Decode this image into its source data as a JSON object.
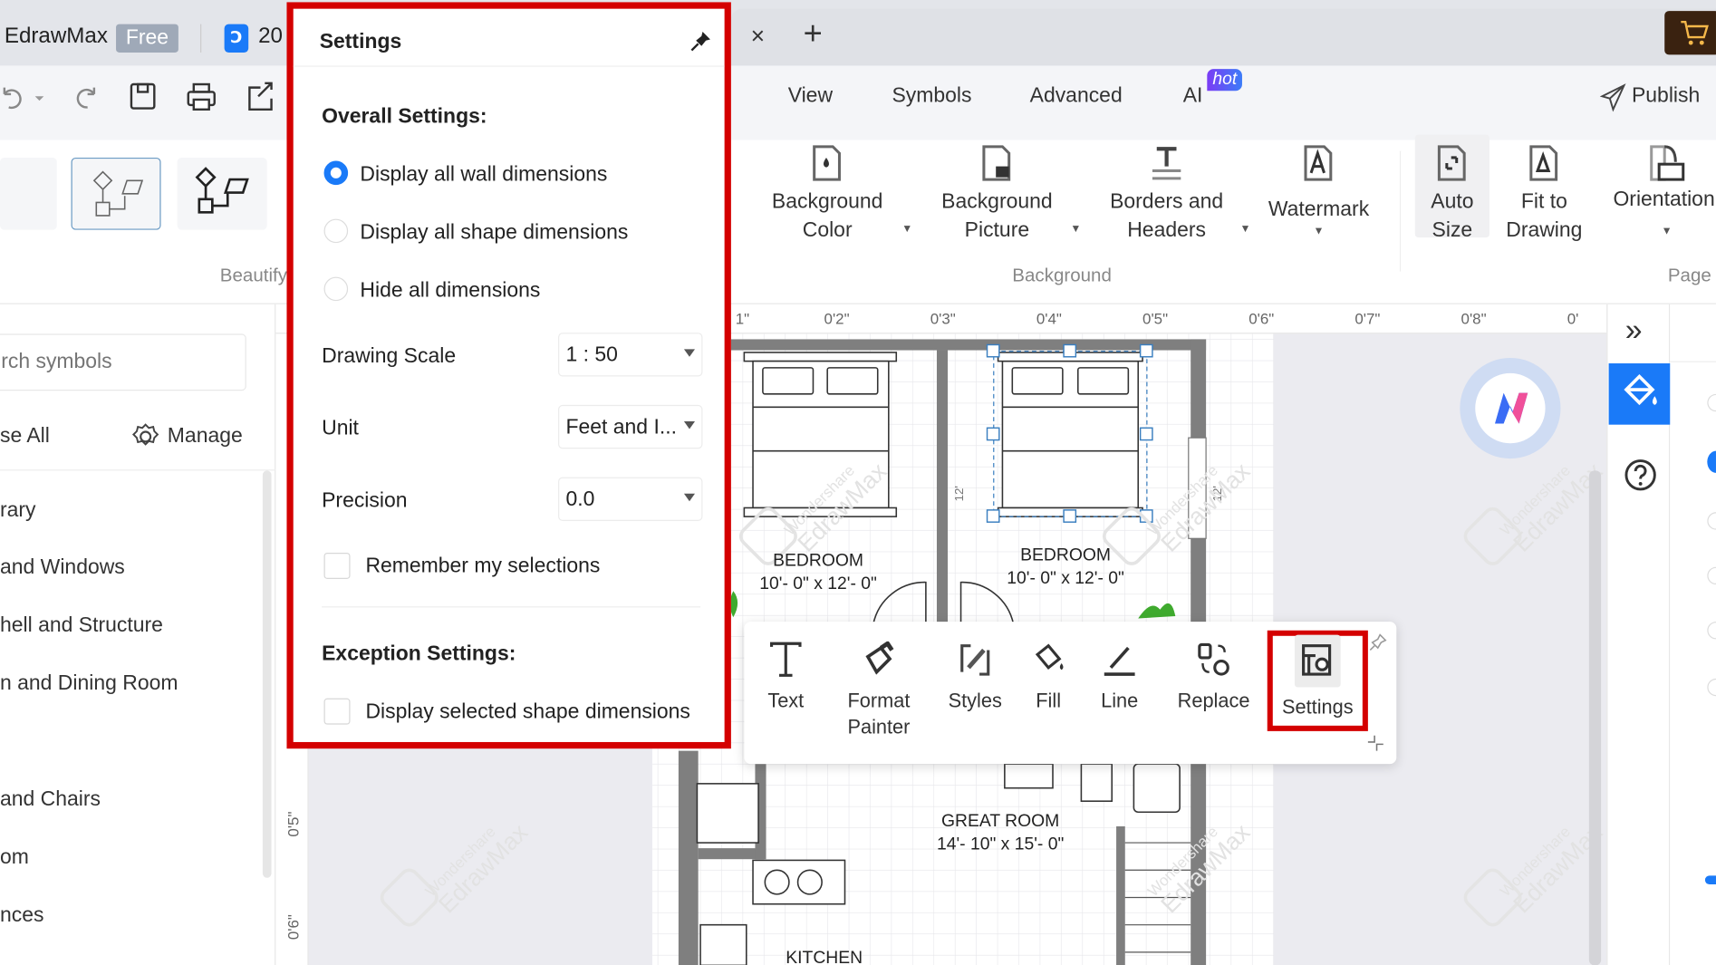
{
  "app": {
    "name": "EdrawMax",
    "plan_badge": "Free",
    "doc_tab_prefix": "20",
    "close_tab": "×",
    "new_tab": "+"
  },
  "menu": {
    "items": [
      "View",
      "Symbols",
      "Advanced",
      "AI"
    ],
    "ai_badge": "hot",
    "publish": "Publish"
  },
  "ribbon": {
    "beautify_label": "Beautify",
    "background_group": "Background",
    "page_group": "Page",
    "background_color": [
      "Background",
      "Color"
    ],
    "background_picture": [
      "Background",
      "Picture"
    ],
    "borders_headers": [
      "Borders and",
      "Headers"
    ],
    "watermark": "Watermark",
    "auto_size": [
      "Auto",
      "Size"
    ],
    "fit_to_drawing": [
      "Fit to",
      "Drawing"
    ],
    "orientation": "Orientation"
  },
  "library": {
    "search_placeholder": "rch symbols",
    "collapse_all": "se All",
    "manage": "Manage",
    "items": [
      "rary",
      "and Windows",
      "hell and Structure",
      "n and Dining Room",
      "and Chairs",
      "om",
      "nces"
    ]
  },
  "ruler": {
    "top": [
      "1\"",
      "0'2\"",
      "0'3\"",
      "0'4\"",
      "0'5\"",
      "0'6\"",
      "0'7\"",
      "0'8\"",
      "0'"
    ],
    "left": [
      "0'5\"",
      "0'6\""
    ]
  },
  "settings_popup": {
    "title": "Settings",
    "overall_heading": "Overall Settings:",
    "options": [
      {
        "label": "Display all wall dimensions",
        "selected": true
      },
      {
        "label": "Display all shape dimensions",
        "selected": false
      },
      {
        "label": "Hide all dimensions",
        "selected": false
      }
    ],
    "drawing_scale_label": "Drawing Scale",
    "drawing_scale_value": "1 : 50",
    "unit_label": "Unit",
    "unit_value": "Feet and I...",
    "precision_label": "Precision",
    "precision_value": "0.0",
    "remember_label": "Remember my selections",
    "remember_checked": false,
    "exception_heading": "Exception Settings:",
    "selected_dims_label": "Display selected shape dimensions",
    "selected_dims_checked": false
  },
  "floating_toolbar": {
    "items": [
      "Text",
      [
        "Format",
        "Painter"
      ],
      "Styles",
      "Fill",
      "Line",
      "Replace",
      "Settings"
    ]
  },
  "floorplan": {
    "rooms": [
      {
        "name": "BEDROOM",
        "size": "10'- 0\" x 12'- 0\""
      },
      {
        "name": "BEDROOM",
        "size": "10'- 0\" x 12'- 0\""
      },
      {
        "name": "GREAT ROOM",
        "size": "14'- 10\" x 15'- 0\""
      },
      {
        "name": "KITCHEN"
      }
    ],
    "dims": [
      "12'",
      "12'"
    ],
    "watermark": [
      "Wondershare",
      "EdrawMax"
    ]
  },
  "colors": {
    "accent": "#1a7af8",
    "highlight_border": "#d40000",
    "wall": "#7f7f7f",
    "cart": "#3a2210"
  }
}
